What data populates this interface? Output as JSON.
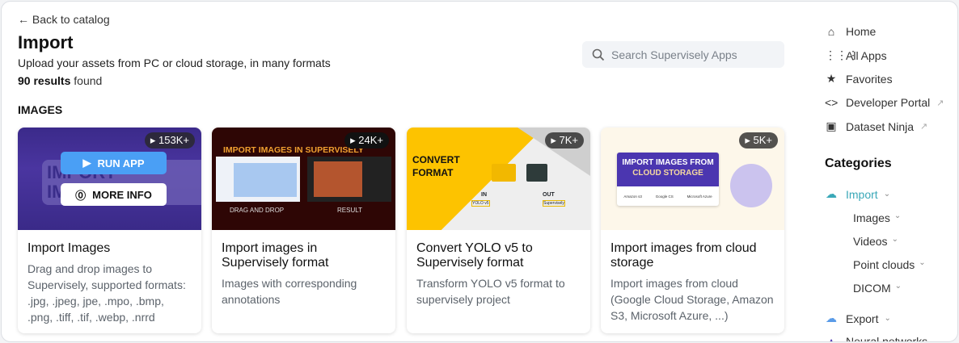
{
  "header": {
    "back": "← Back to catalog",
    "title": "Import",
    "subtitle": "Upload your assets from PC or cloud storage, in many formats",
    "count": "90 results",
    "count_suffix": " found"
  },
  "search": {
    "placeholder": "Search Supervisely Apps"
  },
  "section": "IMAGES",
  "cards": [
    {
      "title": "Import Images",
      "desc": "Drag and drop images to Supervisely, supported formats: .jpg, .jpeg, jpe, .mpo, .bmp, .png, .tiff, .tif, .webp, .nrrd",
      "runs": "153K+",
      "run_label": "RUN APP",
      "info_label": "MORE INFO",
      "thumb_text": "IMPORT IMAGES"
    },
    {
      "title": "Import images in Supervisely format",
      "desc": "Images with corresponding annotations",
      "runs": "24K+",
      "thumb_title": "IMPORT IMAGES IN SUPERVISELY FORMAT",
      "thumb_left": "DRAG AND DROP",
      "thumb_right": "RESULT"
    },
    {
      "title": "Convert YOLO v5 to Supervisely format",
      "desc": "Transform YOLO v5 format to supervisely project",
      "runs": "7K+",
      "thumb_title": "CONVERT FORMAT",
      "in": "IN",
      "in_fmt": "YOLO v5",
      "out": "OUT",
      "out_fmt": "Supervisely"
    },
    {
      "title": "Import images from cloud storage",
      "desc": "Import images from cloud (Google Cloud Storage, Amazon S3, Microsoft Azure, ...)",
      "runs": "5K+",
      "thumb_title1": "IMPORT IMAGES FROM",
      "thumb_title2": "CLOUD STORAGE",
      "providers": [
        "Amazon s3",
        "Google CS",
        "Microsoft Azure"
      ]
    }
  ],
  "nav": [
    {
      "label": "Home",
      "icon": "home-icon"
    },
    {
      "label": "All Apps",
      "icon": "grid-icon"
    },
    {
      "label": "Favorites",
      "icon": "star-icon"
    },
    {
      "label": "Developer Portal",
      "icon": "code-icon"
    },
    {
      "label": "Dataset Ninja",
      "icon": "archive-icon"
    }
  ],
  "categories": {
    "title": "Categories",
    "import": "Import",
    "sub": [
      "Images",
      "Videos",
      "Point clouds",
      "DICOM"
    ],
    "export": "Export",
    "neural": "Neural networks"
  },
  "colors": {
    "accent": "#3aa8b8",
    "run": "#4a9ff5"
  }
}
